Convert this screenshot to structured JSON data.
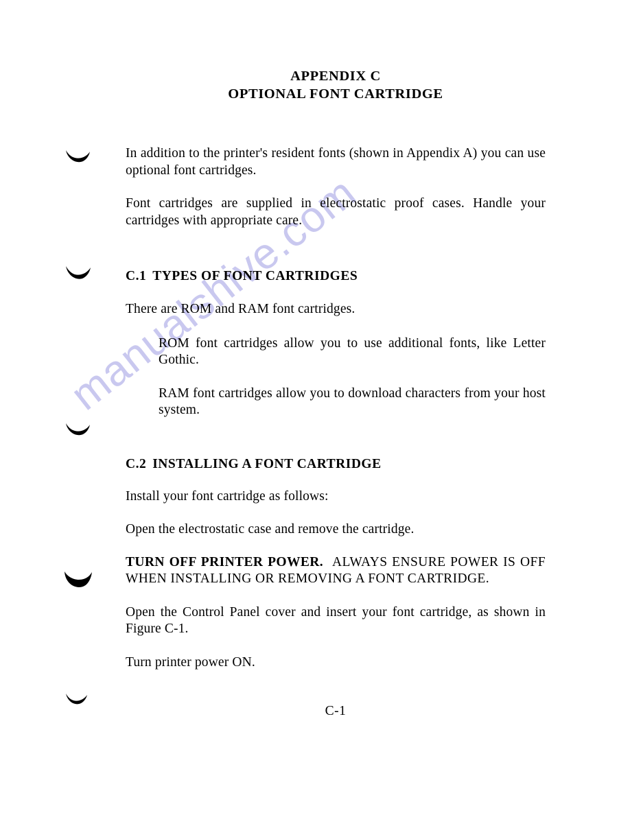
{
  "document": {
    "title_line_1": "APPENDIX C",
    "title_line_2": "OPTIONAL FONT CARTRIDGE",
    "page_number": "C-1"
  },
  "watermark": {
    "text": "manualshive.com",
    "color": "#c9c8ef"
  },
  "intro": {
    "paragraph_1": "In addition to the printer's resident fonts (shown in Appendix A) you can use optional font cartridges.",
    "paragraph_2": "Font cartridges are supplied in electrostatic proof cases. Handle your cartridges with appropriate care."
  },
  "section_c1": {
    "number": "C.1",
    "heading": "TYPES OF FONT CARTRIDGES",
    "paragraph_1": "There are ROM and RAM font cartridges.",
    "bullet_rom": "ROM font cartridges allow you to use additional fonts, like Letter Gothic.",
    "bullet_ram": "RAM font cartridges allow you to download characters from your host system."
  },
  "section_c2": {
    "number": "C.2",
    "heading": "INSTALLING A FONT CARTRIDGE",
    "paragraph_1": "Install your font cartridge as follows:",
    "paragraph_2": "Open the electrostatic case and remove the  cartridge.",
    "warning_bold": "TURN OFF PRINTER POWER.",
    "warning_rest": "ALWAYS ENSURE POWER IS OFF WHEN INSTALLING OR REMOVING A FONT CARTRIDGE.",
    "paragraph_3": "Open the Control Panel cover and insert your font cartridge, as shown in Figure C-1.",
    "paragraph_4": "Turn printer power ON."
  },
  "margin_marks": {
    "description": "hole-punch scan artifacts",
    "count": 5
  }
}
